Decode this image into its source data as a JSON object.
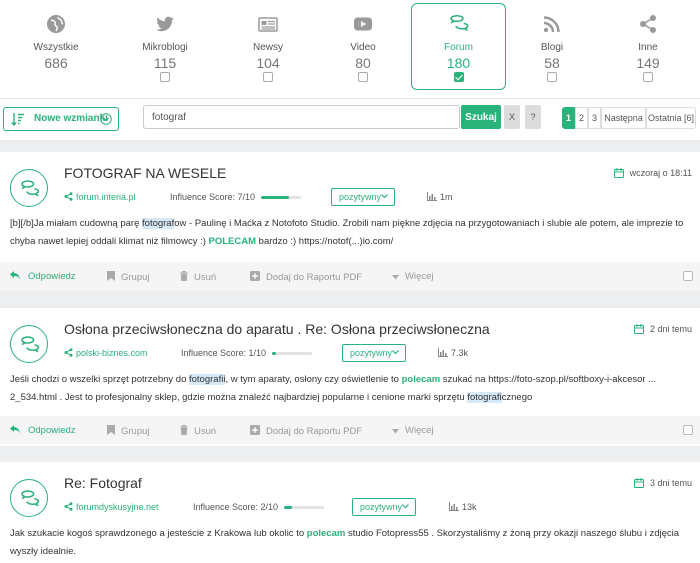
{
  "sources": [
    {
      "label": "Wszystkie",
      "count": "686",
      "icon": "globe-icon"
    },
    {
      "label": "Mikroblogi",
      "count": "115",
      "icon": "twitter-bird-icon"
    },
    {
      "label": "Newsy",
      "count": "104",
      "icon": "newspaper-icon"
    },
    {
      "label": "Video",
      "count": "80",
      "icon": "play-icon"
    },
    {
      "label": "Forum",
      "count": "180",
      "icon": "chat-bubbles-icon",
      "active": true
    },
    {
      "label": "Blogi",
      "count": "58",
      "icon": "rss-icon"
    },
    {
      "label": "Inne",
      "count": "149",
      "icon": "share-icon"
    }
  ],
  "filters": {
    "sort_label": "Nowe wzmianki",
    "search_value": "fotograf",
    "search_button": "Szukaj",
    "clear_button": "X",
    "help_button": "?"
  },
  "pagination": {
    "pages": [
      "1",
      "2",
      "3"
    ],
    "next": "Następna",
    "last": "Ostatnia [6]"
  },
  "actions": {
    "reply": "Odpowiedz",
    "group": "Grupuj",
    "delete": "Usuń",
    "pdf": "Dodaj do Raportu PDF",
    "more": "Więcej"
  },
  "mentions": [
    {
      "title": "FOTOGRAF NA WESELE",
      "date": "wczoraj o 18:11",
      "source": "forum.interia.pl",
      "influence": "Influence Score: 7/10",
      "influence_fraction": 0.7,
      "sentiment": "pozytywny",
      "reach": "1m",
      "text_parts": {
        "p1": "[b][/b]Ja miałam cudowną parę ",
        "h1": "fotograf",
        "p2": "ow - Paulinę i Maćka z Notofoto Studio. Zrobili nam piękne zdjęcia na przygotowaniach i slubie ale potem, ale imprezie to chyba nawet lepiej oddali klimat niż filmowcy :) ",
        "k1": "POLECAM",
        "p3": " bardzo :) https://notof(...)io.com/"
      }
    },
    {
      "title": "Osłona przeciwsłoneczna do aparatu . Re: Osłona przeciwsłoneczna",
      "date": "2 dni temu",
      "source": "polski-biznes.com",
      "influence": "Influence Score: 1/10",
      "influence_fraction": 0.1,
      "sentiment": "pozytywny",
      "reach": "7.3k",
      "text_parts": {
        "p1": "Jeśli chodzi o wszelki sprzęt potrzebny do ",
        "h1": "fotografii",
        "p2": ", w tym aparaty, osłony czy oświetlenie to ",
        "k1": "polecam",
        "p3": " szukać na https://foto-szop.pl/softboxy-i-akcesor ... 2_534.html . Jest to profesjonalny sklep, gdzie można znaleźć najbardziej popularne i cenione marki sprzętu ",
        "h2": "fotografi",
        "p4": "cznego"
      }
    },
    {
      "title": "Re: Fotograf",
      "date": "3 dni temu",
      "source": "forumdyskusyjne.net",
      "influence": "Influence Score: 2/10",
      "influence_fraction": 0.2,
      "sentiment": "pozytywny",
      "reach": "13k",
      "text_parts": {
        "p1": "Jak szukacie kogoś sprawdzonego a jesteście z Krakowa lub okolic to ",
        "k1": "polecam",
        "p2": " studio Fotopress55 . Skorzystaliśmy z żoną przy okazji naszego ślubu i zdjęcia wyszły idealnie."
      }
    }
  ]
}
